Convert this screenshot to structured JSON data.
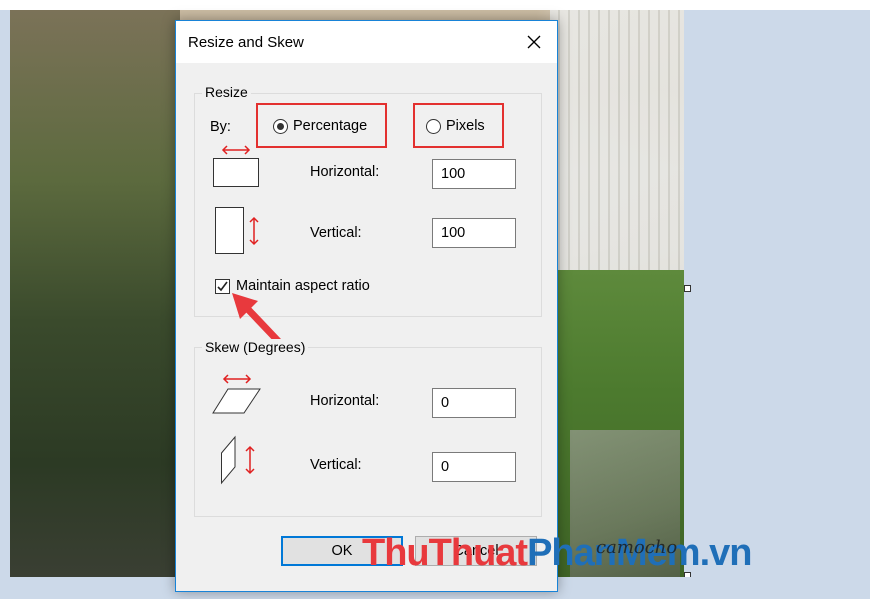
{
  "dialog": {
    "title": "Resize and Skew",
    "resize": {
      "group_label": "Resize",
      "by_label": "By:",
      "percentage_label": "Percentage",
      "pixels_label": "Pixels",
      "selected": "Percentage",
      "horizontal_label": "Horizontal:",
      "horizontal_value": "100",
      "vertical_label": "Vertical:",
      "vertical_value": "100",
      "maintain_label": "Maintain aspect ratio",
      "maintain_checked": true
    },
    "skew": {
      "group_label": "Skew (Degrees)",
      "horizontal_label": "Horizontal:",
      "horizontal_value": "0",
      "vertical_label": "Vertical:",
      "vertical_value": "0"
    },
    "ok_label": "OK",
    "cancel_label": "Cancel"
  },
  "watermark": {
    "part1": "Thu",
    "part2": "Thuat",
    "part3": "PhanMem",
    "part4": ".vn",
    "signature": "camocho"
  },
  "colors": {
    "highlight": "#e3302f",
    "accent": "#0078d7",
    "arrow_icon": "#e02020"
  }
}
